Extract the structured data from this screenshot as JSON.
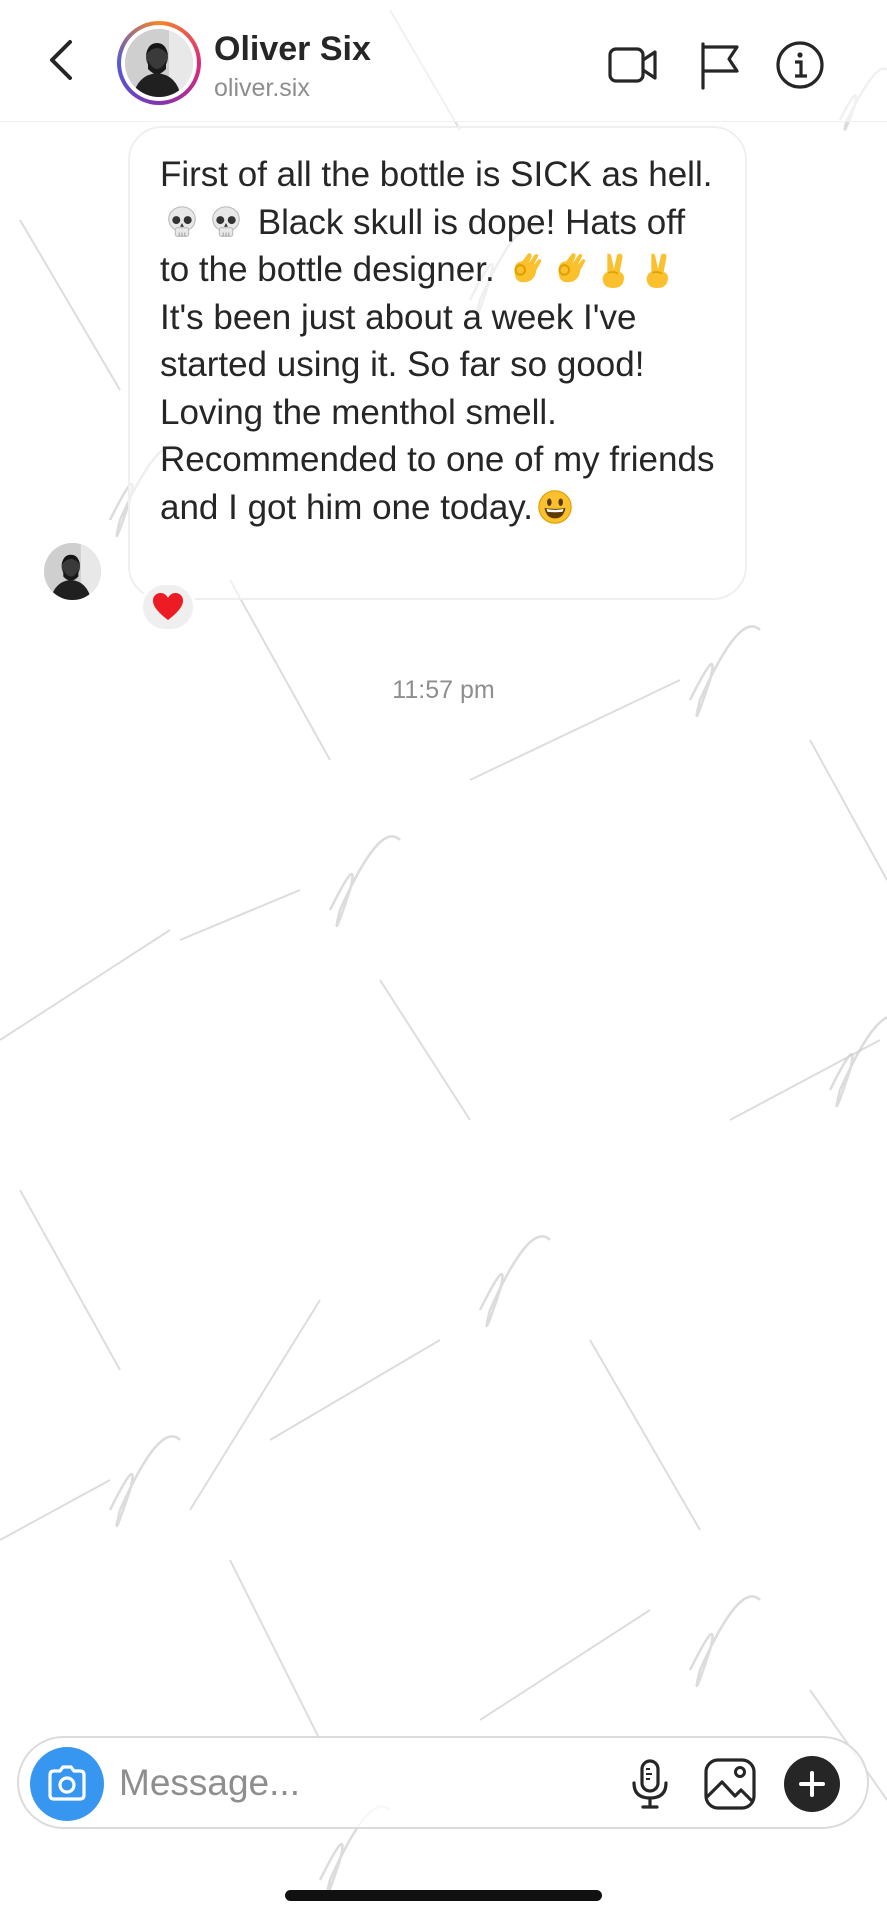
{
  "header": {
    "name": "Oliver Six",
    "username": "oliver.six",
    "icons": [
      "chevron-left-icon",
      "video-camera-icon",
      "flag-icon",
      "info-icon"
    ]
  },
  "message": {
    "text_part1": "First of all the bottle is SICK as hell.",
    "text_part2": "Black skull is dope! Hats off to the bottle designer.",
    "text_part3": "It's been just about a week I've started using it. So far so good! Loving the menthol smell. Recommended to one of my friends and I got him one today.",
    "emojis": [
      "skull",
      "skull",
      "ok-hand",
      "ok-hand",
      "victory-hand",
      "victory-hand",
      "grinning-face"
    ],
    "reaction": "heart"
  },
  "timestamp": "11:57 pm",
  "composer": {
    "placeholder": "Message...",
    "icons": [
      "camera-icon",
      "microphone-icon",
      "gallery-icon",
      "plus-icon"
    ]
  },
  "colors": {
    "accent_blue": "#3797f0",
    "text_primary": "#262626",
    "text_secondary": "#8e8e8e",
    "heart_red": "#ed1c24"
  }
}
